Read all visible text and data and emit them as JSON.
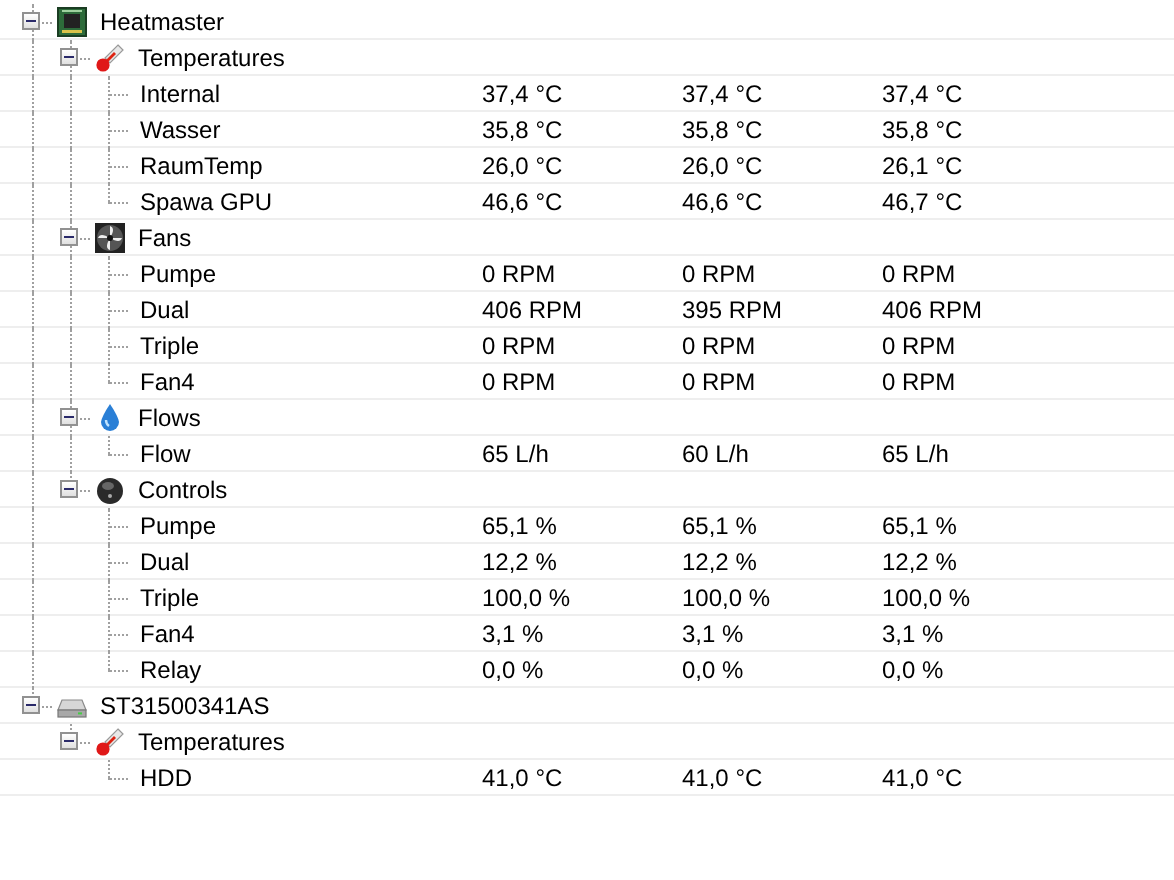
{
  "tree": [
    {
      "label": "Heatmaster",
      "kind": "board",
      "expanded": true,
      "children": [
        {
          "label": "Temperatures",
          "kind": "temperature",
          "expanded": true,
          "children": [
            {
              "label": "Internal",
              "values": [
                "37,4 °C",
                "37,4 °C",
                "37,4 °C"
              ]
            },
            {
              "label": "Wasser",
              "values": [
                "35,8 °C",
                "35,8 °C",
                "35,8 °C"
              ]
            },
            {
              "label": "RaumTemp",
              "values": [
                "26,0 °C",
                "26,0 °C",
                "26,1 °C"
              ]
            },
            {
              "label": "Spawa GPU",
              "values": [
                "46,6 °C",
                "46,6 °C",
                "46,7 °C"
              ]
            }
          ]
        },
        {
          "label": "Fans",
          "kind": "fan",
          "expanded": true,
          "children": [
            {
              "label": "Pumpe",
              "values": [
                "0 RPM",
                "0 RPM",
                "0 RPM"
              ]
            },
            {
              "label": "Dual",
              "values": [
                "406 RPM",
                "395 RPM",
                "406 RPM"
              ]
            },
            {
              "label": "Triple",
              "values": [
                "0 RPM",
                "0 RPM",
                "0 RPM"
              ]
            },
            {
              "label": "Fan4",
              "values": [
                "0 RPM",
                "0 RPM",
                "0 RPM"
              ]
            }
          ]
        },
        {
          "label": "Flows",
          "kind": "flow",
          "expanded": true,
          "children": [
            {
              "label": "Flow",
              "values": [
                "65 L/h",
                "60 L/h",
                "65 L/h"
              ]
            }
          ]
        },
        {
          "label": "Controls",
          "kind": "control",
          "expanded": true,
          "children": [
            {
              "label": "Pumpe",
              "values": [
                "65,1 %",
                "65,1 %",
                "65,1 %"
              ]
            },
            {
              "label": "Dual",
              "values": [
                "12,2 %",
                "12,2 %",
                "12,2 %"
              ]
            },
            {
              "label": "Triple",
              "values": [
                "100,0 %",
                "100,0 %",
                "100,0 %"
              ]
            },
            {
              "label": "Fan4",
              "values": [
                "3,1 %",
                "3,1 %",
                "3,1 %"
              ]
            },
            {
              "label": "Relay",
              "values": [
                "0,0 %",
                "0,0 %",
                "0,0 %"
              ]
            }
          ]
        }
      ]
    },
    {
      "label": "ST31500341AS",
      "kind": "disk",
      "expanded": true,
      "children": [
        {
          "label": "Temperatures",
          "kind": "temperature",
          "expanded": true,
          "children": [
            {
              "label": "HDD",
              "values": [
                "41,0 °C",
                "41,0 °C",
                "41,0 °C"
              ]
            }
          ]
        }
      ]
    }
  ]
}
